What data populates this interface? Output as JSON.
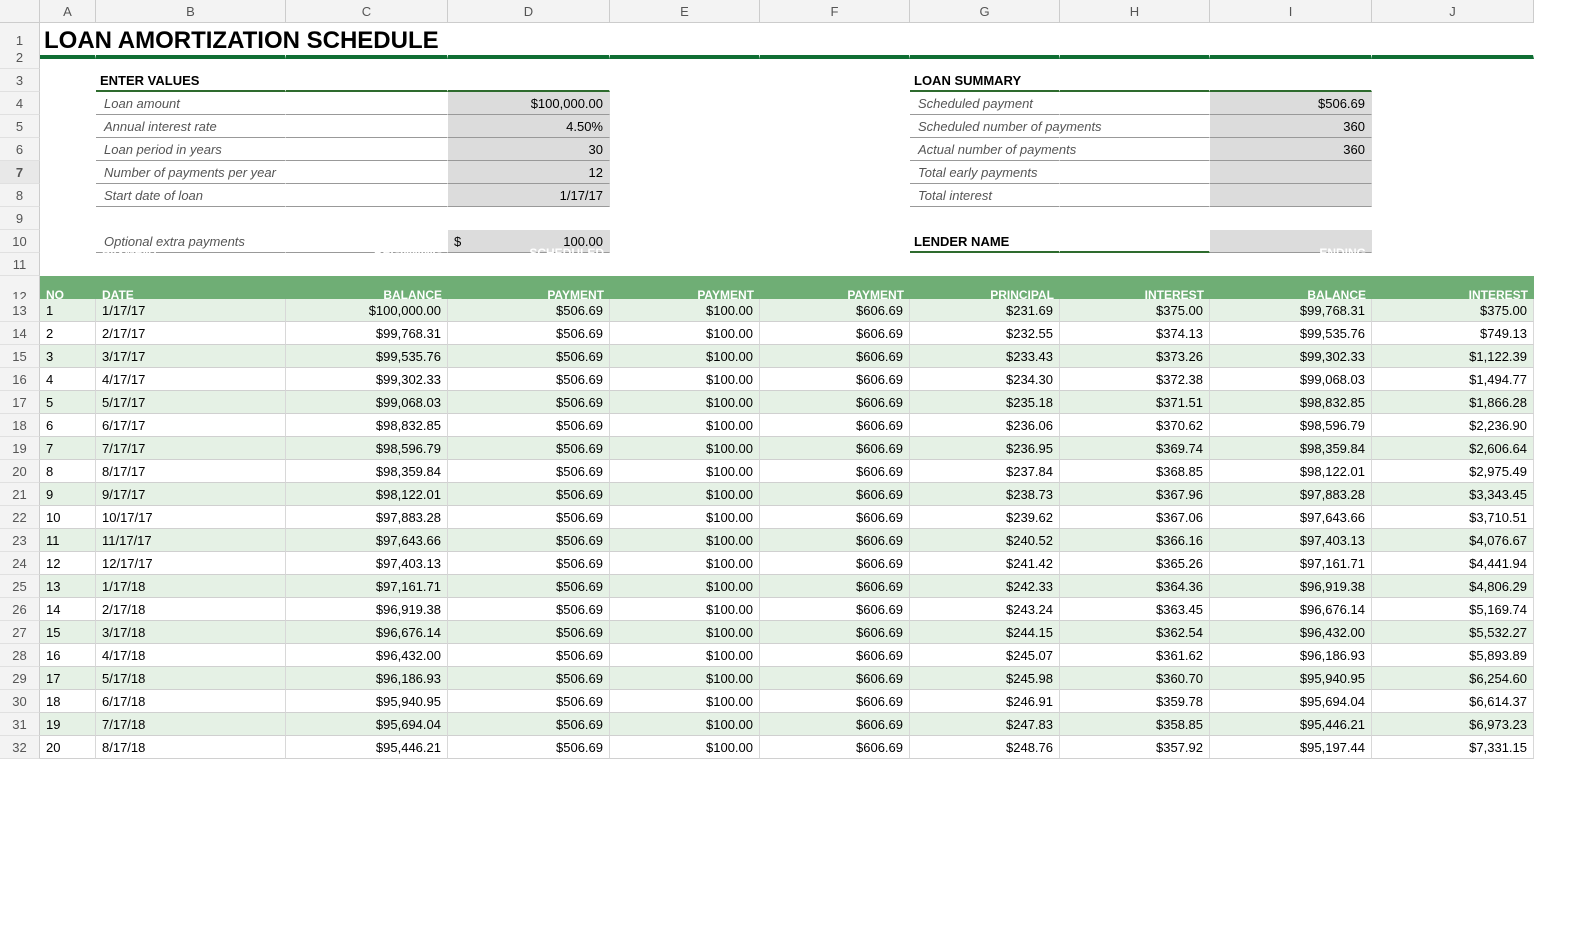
{
  "columns": [
    "A",
    "B",
    "C",
    "D",
    "E",
    "F",
    "G",
    "H",
    "I",
    "J"
  ],
  "rowCount": 32,
  "selectedRow": 7,
  "title": "LOAN AMORTIZATION SCHEDULE",
  "sections": {
    "enter": "ENTER VALUES",
    "summary": "LOAN SUMMARY",
    "lender": "LENDER NAME"
  },
  "inputs": {
    "loan_amount": {
      "label": "Loan amount",
      "value": "$100,000.00"
    },
    "annual_rate": {
      "label": "Annual interest rate",
      "value": "4.50%"
    },
    "period_years": {
      "label": "Loan period in years",
      "value": "30"
    },
    "payments_per_year": {
      "label": "Number of payments per year",
      "value": "12"
    },
    "start_date": {
      "label": "Start date of loan",
      "value": "1/17/17"
    },
    "extra_payments": {
      "label": "Optional extra payments",
      "prefix": "$",
      "value": "100.00"
    }
  },
  "summary": {
    "scheduled_payment": {
      "label": "Scheduled payment",
      "value": "$506.69"
    },
    "scheduled_num": {
      "label": "Scheduled number of payments",
      "value": "360"
    },
    "actual_num": {
      "label": "Actual number of payments",
      "value": "360"
    },
    "total_early": {
      "label": "Total early payments",
      "value": ""
    },
    "total_interest": {
      "label": "Total interest",
      "value": ""
    }
  },
  "table": {
    "headers": {
      "pmt_no": "PMT NO",
      "pmt_date": "PAYMENT DATE",
      "beg_bal": "BEGINNING BALANCE",
      "sched": "SCHEDULED PAYMENT",
      "extra": "EXTRA PAYMENT",
      "total": "TOTAL PAYMENT",
      "principal": "PRINCIPAL",
      "interest": "INTEREST",
      "end_bal": "ENDING BALANCE",
      "cum_int": "CUMULATIVE INTEREST"
    },
    "rows": [
      {
        "no": "1",
        "date": "1/17/17",
        "beg": "$100,000.00",
        "sched": "$506.69",
        "extra": "$100.00",
        "total": "$606.69",
        "prin": "$231.69",
        "int": "$375.00",
        "end": "$99,768.31",
        "cum": "$375.00"
      },
      {
        "no": "2",
        "date": "2/17/17",
        "beg": "$99,768.31",
        "sched": "$506.69",
        "extra": "$100.00",
        "total": "$606.69",
        "prin": "$232.55",
        "int": "$374.13",
        "end": "$99,535.76",
        "cum": "$749.13"
      },
      {
        "no": "3",
        "date": "3/17/17",
        "beg": "$99,535.76",
        "sched": "$506.69",
        "extra": "$100.00",
        "total": "$606.69",
        "prin": "$233.43",
        "int": "$373.26",
        "end": "$99,302.33",
        "cum": "$1,122.39"
      },
      {
        "no": "4",
        "date": "4/17/17",
        "beg": "$99,302.33",
        "sched": "$506.69",
        "extra": "$100.00",
        "total": "$606.69",
        "prin": "$234.30",
        "int": "$372.38",
        "end": "$99,068.03",
        "cum": "$1,494.77"
      },
      {
        "no": "5",
        "date": "5/17/17",
        "beg": "$99,068.03",
        "sched": "$506.69",
        "extra": "$100.00",
        "total": "$606.69",
        "prin": "$235.18",
        "int": "$371.51",
        "end": "$98,832.85",
        "cum": "$1,866.28"
      },
      {
        "no": "6",
        "date": "6/17/17",
        "beg": "$98,832.85",
        "sched": "$506.69",
        "extra": "$100.00",
        "total": "$606.69",
        "prin": "$236.06",
        "int": "$370.62",
        "end": "$98,596.79",
        "cum": "$2,236.90"
      },
      {
        "no": "7",
        "date": "7/17/17",
        "beg": "$98,596.79",
        "sched": "$506.69",
        "extra": "$100.00",
        "total": "$606.69",
        "prin": "$236.95",
        "int": "$369.74",
        "end": "$98,359.84",
        "cum": "$2,606.64"
      },
      {
        "no": "8",
        "date": "8/17/17",
        "beg": "$98,359.84",
        "sched": "$506.69",
        "extra": "$100.00",
        "total": "$606.69",
        "prin": "$237.84",
        "int": "$368.85",
        "end": "$98,122.01",
        "cum": "$2,975.49"
      },
      {
        "no": "9",
        "date": "9/17/17",
        "beg": "$98,122.01",
        "sched": "$506.69",
        "extra": "$100.00",
        "total": "$606.69",
        "prin": "$238.73",
        "int": "$367.96",
        "end": "$97,883.28",
        "cum": "$3,343.45"
      },
      {
        "no": "10",
        "date": "10/17/17",
        "beg": "$97,883.28",
        "sched": "$506.69",
        "extra": "$100.00",
        "total": "$606.69",
        "prin": "$239.62",
        "int": "$367.06",
        "end": "$97,643.66",
        "cum": "$3,710.51"
      },
      {
        "no": "11",
        "date": "11/17/17",
        "beg": "$97,643.66",
        "sched": "$506.69",
        "extra": "$100.00",
        "total": "$606.69",
        "prin": "$240.52",
        "int": "$366.16",
        "end": "$97,403.13",
        "cum": "$4,076.67"
      },
      {
        "no": "12",
        "date": "12/17/17",
        "beg": "$97,403.13",
        "sched": "$506.69",
        "extra": "$100.00",
        "total": "$606.69",
        "prin": "$241.42",
        "int": "$365.26",
        "end": "$97,161.71",
        "cum": "$4,441.94"
      },
      {
        "no": "13",
        "date": "1/17/18",
        "beg": "$97,161.71",
        "sched": "$506.69",
        "extra": "$100.00",
        "total": "$606.69",
        "prin": "$242.33",
        "int": "$364.36",
        "end": "$96,919.38",
        "cum": "$4,806.29"
      },
      {
        "no": "14",
        "date": "2/17/18",
        "beg": "$96,919.38",
        "sched": "$506.69",
        "extra": "$100.00",
        "total": "$606.69",
        "prin": "$243.24",
        "int": "$363.45",
        "end": "$96,676.14",
        "cum": "$5,169.74"
      },
      {
        "no": "15",
        "date": "3/17/18",
        "beg": "$96,676.14",
        "sched": "$506.69",
        "extra": "$100.00",
        "total": "$606.69",
        "prin": "$244.15",
        "int": "$362.54",
        "end": "$96,432.00",
        "cum": "$5,532.27"
      },
      {
        "no": "16",
        "date": "4/17/18",
        "beg": "$96,432.00",
        "sched": "$506.69",
        "extra": "$100.00",
        "total": "$606.69",
        "prin": "$245.07",
        "int": "$361.62",
        "end": "$96,186.93",
        "cum": "$5,893.89"
      },
      {
        "no": "17",
        "date": "5/17/18",
        "beg": "$96,186.93",
        "sched": "$506.69",
        "extra": "$100.00",
        "total": "$606.69",
        "prin": "$245.98",
        "int": "$360.70",
        "end": "$95,940.95",
        "cum": "$6,254.60"
      },
      {
        "no": "18",
        "date": "6/17/18",
        "beg": "$95,940.95",
        "sched": "$506.69",
        "extra": "$100.00",
        "total": "$606.69",
        "prin": "$246.91",
        "int": "$359.78",
        "end": "$95,694.04",
        "cum": "$6,614.37"
      },
      {
        "no": "19",
        "date": "7/17/18",
        "beg": "$95,694.04",
        "sched": "$506.69",
        "extra": "$100.00",
        "total": "$606.69",
        "prin": "$247.83",
        "int": "$358.85",
        "end": "$95,446.21",
        "cum": "$6,973.23"
      },
      {
        "no": "20",
        "date": "8/17/18",
        "beg": "$95,446.21",
        "sched": "$506.69",
        "extra": "$100.00",
        "total": "$606.69",
        "prin": "$248.76",
        "int": "$357.92",
        "end": "$95,197.44",
        "cum": "$7,331.15"
      }
    ]
  }
}
